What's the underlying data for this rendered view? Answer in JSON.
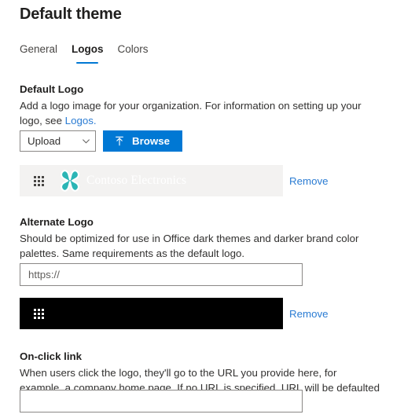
{
  "header": {
    "title": "Default theme"
  },
  "tabs": [
    {
      "label": "General",
      "active": false
    },
    {
      "label": "Logos",
      "active": true
    },
    {
      "label": "Colors",
      "active": false
    }
  ],
  "default_logo": {
    "label": "Default Logo",
    "description": "Add a logo image for your organization. For information on setting up your logo, see ",
    "link_text": "Logos.",
    "source_select": {
      "value": "Upload",
      "icon": "chevron-down-icon"
    },
    "browse_button": {
      "label": "Browse",
      "icon": "upload-icon"
    },
    "preview": {
      "waffle_icon": "waffle-grid-icon",
      "logo_icon": "contoso-butterfly-logo-icon",
      "brand_text": "Contoso Electronics",
      "background_color": "#f3f2f1",
      "brand_text_color": "#ffffff",
      "logo_color": "#2bb5b5"
    },
    "remove_label": "Remove"
  },
  "alternate_logo": {
    "label": "Alternate Logo",
    "description": "Should be optimized for use in Office dark themes and darker brand color palettes. Same requirements as the default logo.",
    "url_input": {
      "value": "",
      "placeholder": "https://"
    },
    "preview": {
      "waffle_icon": "waffle-grid-icon",
      "background_color": "#000000"
    },
    "remove_label": "Remove"
  },
  "onclick_link": {
    "label": "On-click link",
    "description": "When users click the logo, they'll go to the URL you provide here, for example, a company home page. If no URL is specified, URL will be defaulted to Office homepage.",
    "url_input": {
      "value": "",
      "placeholder": ""
    }
  },
  "colors": {
    "accent": "#0078d4",
    "link": "#2b7cd3",
    "text": "#201f1e",
    "border": "#8a8886"
  }
}
